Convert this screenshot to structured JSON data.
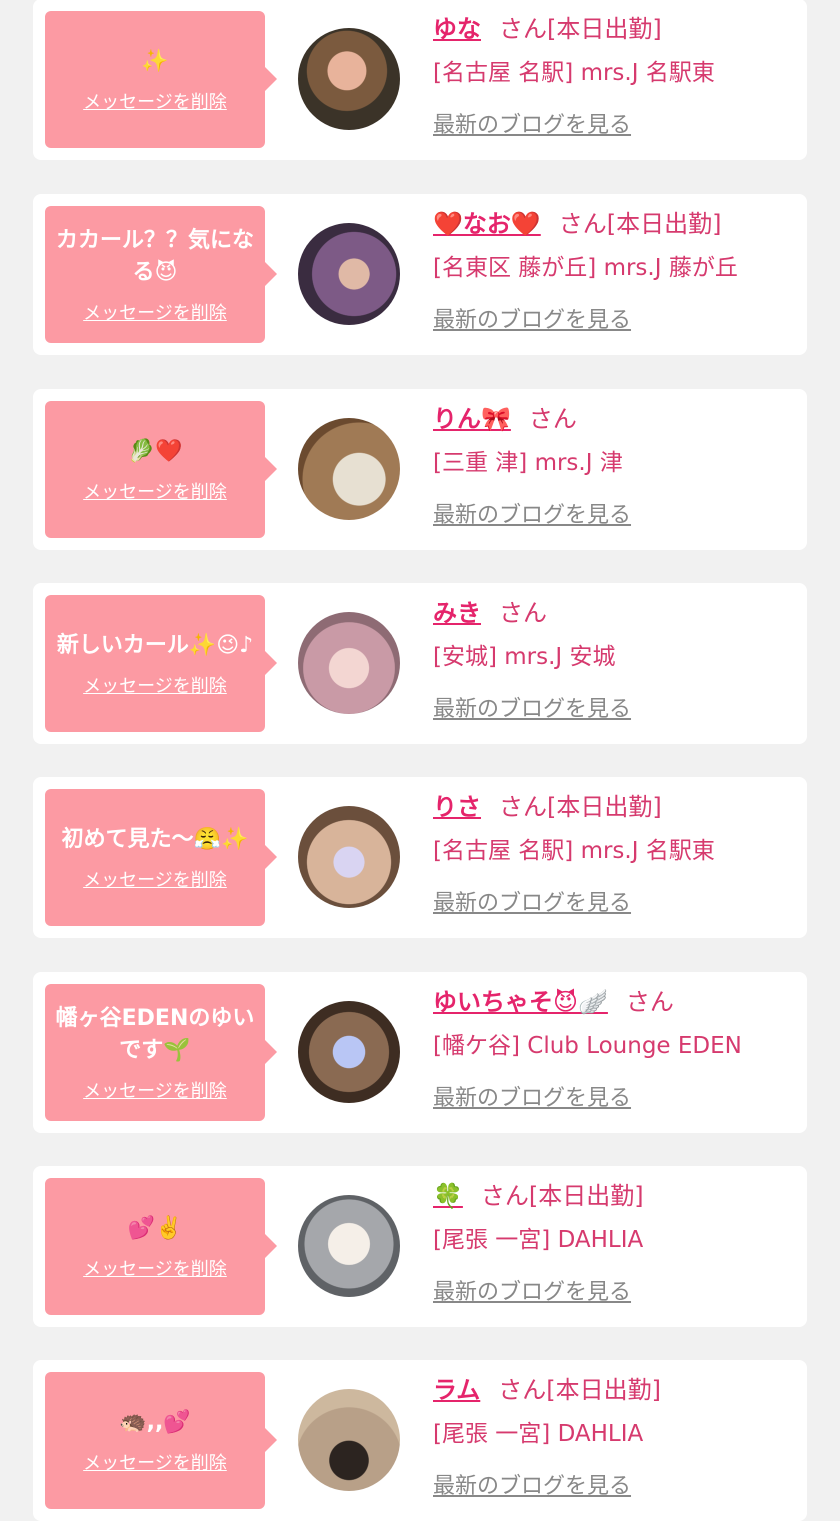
{
  "colors": {
    "bubble": "#fc9aa3",
    "name": "#e5246b",
    "text": "#d63a6e",
    "link_gray": "#888888",
    "background": "#f1f1f1"
  },
  "labels": {
    "delete": "メッセージを削除",
    "blog": "最新のブログを見る"
  },
  "items": [
    {
      "message": "✨",
      "name": "ゆな",
      "suffix": "さん[本日出勤]",
      "shop": "[名古屋 名駅] mrs.J 名駅東",
      "avatar_icon": "avatar-photo-icon"
    },
    {
      "message": "カカール？？気になる😈",
      "name": "❤️なお❤️",
      "suffix": "さん[本日出勤]",
      "shop": "[名東区 藤が丘] mrs.J 藤が丘",
      "avatar_icon": "avatar-photo-icon"
    },
    {
      "message": "🥬❤️",
      "name": "りん🎀",
      "suffix": "さん",
      "shop": "[三重 津] mrs.J 津",
      "avatar_icon": "avatar-photo-icon"
    },
    {
      "message": "新しいカール✨😉♪",
      "name": "みき",
      "suffix": "さん",
      "shop": "[安城] mrs.J 安城",
      "avatar_icon": "avatar-photo-icon"
    },
    {
      "message": "初めて見た〜😤✨",
      "name": "りさ",
      "suffix": "さん[本日出勤]",
      "shop": "[名古屋 名駅] mrs.J 名駅東",
      "avatar_icon": "avatar-photo-icon"
    },
    {
      "message": "幡ヶ谷EDENのゆいです🌱",
      "name": "ゆいちゃそ😈🪽",
      "suffix": "さん",
      "shop": "[幡ケ谷] Club Lounge EDEN",
      "avatar_icon": "avatar-photo-icon"
    },
    {
      "message": "💕✌️",
      "name": "🍀",
      "suffix": "さん[本日出勤]",
      "shop": "[尾張 一宮] DAHLIA",
      "avatar_icon": "avatar-photo-icon"
    },
    {
      "message": "🦔,,💕",
      "name": "ラム",
      "suffix": "さん[本日出勤]",
      "shop": "[尾張 一宮] DAHLIA",
      "avatar_icon": "avatar-photo-icon"
    }
  ]
}
